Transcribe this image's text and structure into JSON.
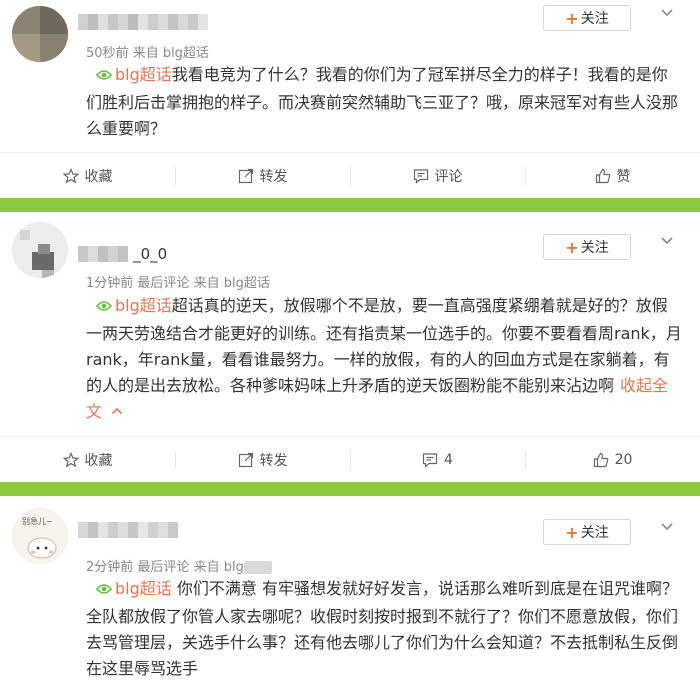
{
  "posts": [
    {
      "username": "",
      "time": "50秒前",
      "source": "来自 blg超话",
      "follow_label": "关注",
      "topic": "blg超话",
      "text": "我看电竞为了什么？我看的你们为了冠军拼尽全力的样子！我看的是你们胜利后击掌拥抱的样子。而决赛前突然辅助飞三亚了？哦，原来冠军对有些人没那么重要啊？",
      "actions": {
        "favorite": "收藏",
        "repost": "转发",
        "comment": "评论",
        "like": "赞"
      }
    },
    {
      "username": "_0_0",
      "time": "1分钟前",
      "last_comment": "最后评论",
      "source": "来自 blg超话",
      "follow_label": "关注",
      "topic": "blg超话",
      "text": "超话真的逆天，放假哪个不是放，要一直高强度紧绷着就是好的？放假一两天劳逸结合才能更好的训练。还有指责某一位选手的。你要不要看看周rank，月rank，年rank量，看看谁最努力。一样的放假，有的人的回血方式是在家躺着，有的人的是出去放松。各种爹味妈味上升矛盾的逆天饭圈粉能不能别来沾边啊",
      "collapse": "收起全文",
      "actions": {
        "favorite": "收藏",
        "repost": "转发",
        "comment": "4",
        "like": "20"
      }
    },
    {
      "username": "",
      "avatar_caption": "别急儿~",
      "time": "2分钟前",
      "last_comment": "最后评论",
      "source_partial": "来自 blg",
      "follow_label": "关注",
      "topic": "blg超话",
      "text": "你们不满意 有牢骚想发就好好发言，说话那么难听到底是在诅咒谁啊？全队都放假了你管人家去哪呢？收假时刻按时报到不就行了？你们不愿意放假，你们去骂管理层，关选手什么事？还有他去哪儿了你们为什么会知道？不去抵制私生反倒在这里辱骂选手"
    }
  ],
  "colors": {
    "accent": "#eb7350",
    "separator": "#8dc63f",
    "plus": "#f77234"
  },
  "icons": [
    "star-icon",
    "repost-icon",
    "comment-icon",
    "thumbs-up-icon",
    "topic-eye-icon",
    "chevron-down-icon"
  ]
}
